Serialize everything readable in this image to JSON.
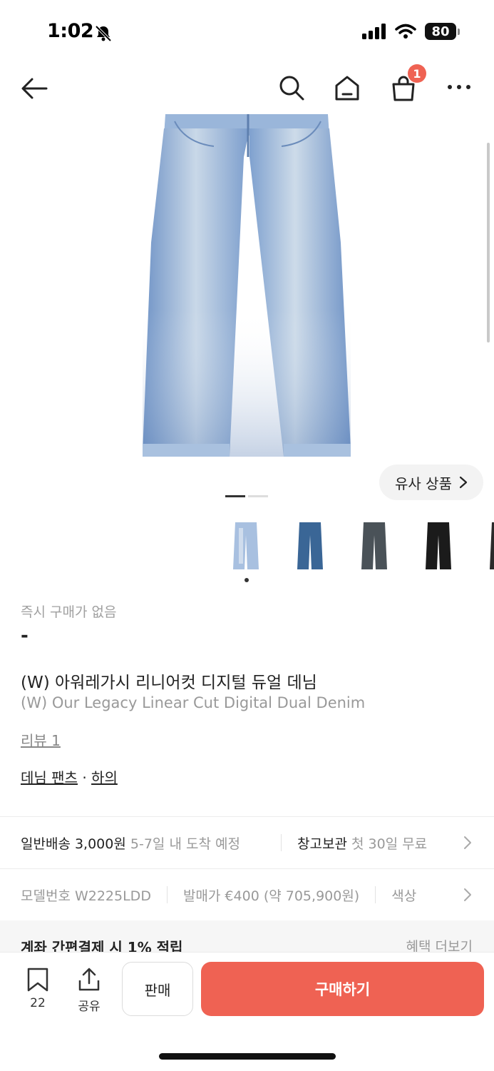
{
  "status": {
    "time": "1:02",
    "battery": "80"
  },
  "nav": {
    "cart_count": "1"
  },
  "gallery": {
    "similar_label": "유사 상품",
    "thumb_count": 5
  },
  "product": {
    "instant_buy_label": "즉시 구매가 없음",
    "price": "-",
    "title_ko": "(W) 아워레가시 리니어컷 디지털 듀얼 데님",
    "title_en": "(W) Our Legacy Linear Cut Digital Dual Denim",
    "review": "리뷰 1",
    "category_1": "데님 팬츠",
    "category_sep": "·",
    "category_2": "하의"
  },
  "shipping": {
    "normal_label": "일반배송 3,000원",
    "normal_eta": "5-7일 내 도착 예정",
    "warehouse_label": "창고보관",
    "warehouse_note": "첫 30일 무료"
  },
  "specs": {
    "model": "모델번호 W2225LDD",
    "release_price": "발매가 €400 (약 705,900원)",
    "color": "색상"
  },
  "benefit": {
    "label": "계좌 간편결제 시 1% 적립",
    "more": "혜택 더보기"
  },
  "actions": {
    "bookmark_count": "22",
    "share_label": "공유",
    "sell_label": "판매",
    "buy_label": "구매하기"
  },
  "colors": {
    "accent": "#ef6253",
    "denim_light": "#8fb0d8",
    "denim_dark": "#2f4f72"
  }
}
